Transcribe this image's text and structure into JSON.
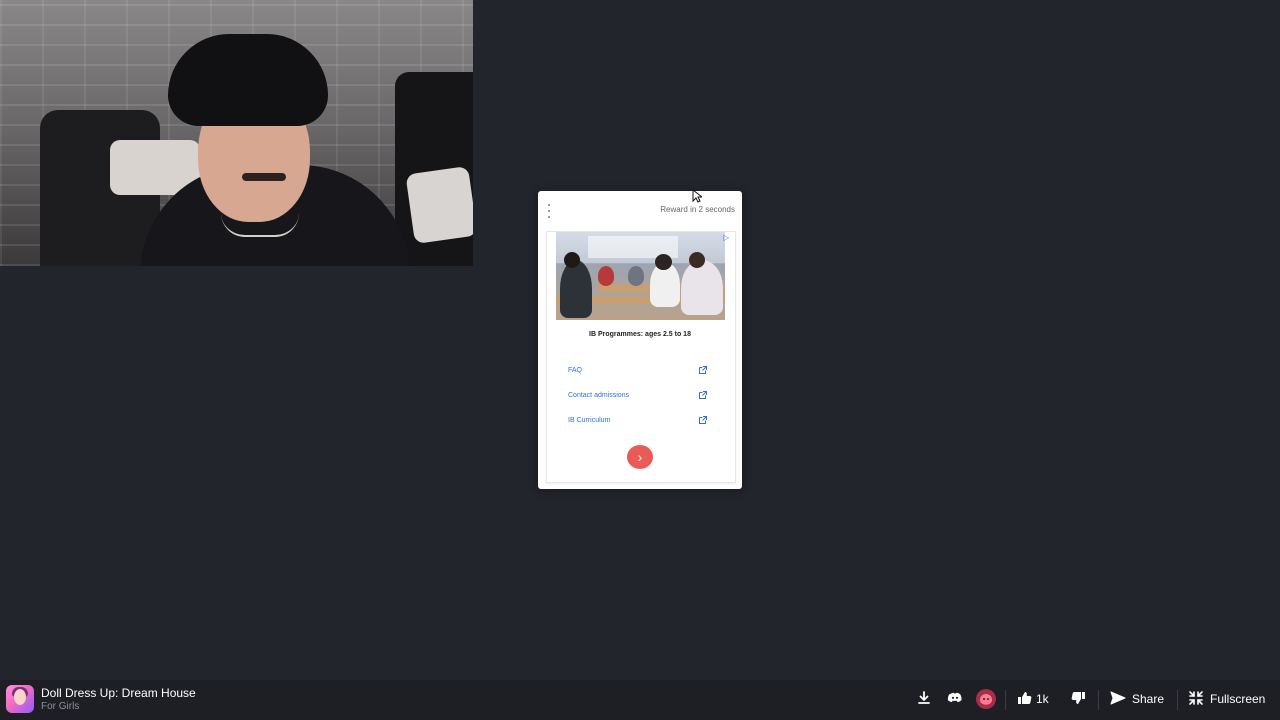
{
  "ad": {
    "reward_text": "Reward in 2 seconds",
    "title": "IB Programmes: ages 2.5 to 18",
    "links": [
      "FAQ",
      "Contact admissions",
      "IB Curriculum"
    ]
  },
  "game": {
    "title": "Doll Dress Up: Dream House",
    "category": "For Girls"
  },
  "actions": {
    "like_count": "1k",
    "share_label": "Share",
    "fullscreen_label": "Fullscreen"
  },
  "colors": {
    "background": "#23252c",
    "bar": "#1d1f24",
    "accent_red": "#ea5b57",
    "active_pink": "#a42f47",
    "link_blue": "#2f6fd8"
  },
  "icons": [
    "download-icon",
    "discord-icon",
    "creator-icon",
    "thumbs-up-icon",
    "thumbs-down-icon",
    "share-icon",
    "fullscreen-icon"
  ]
}
